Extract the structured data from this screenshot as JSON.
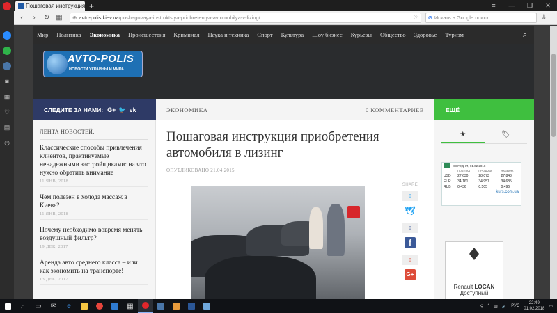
{
  "browser": {
    "tab_title": "Пошаговая инструкция п",
    "tab_close": "×",
    "new_tab": "+",
    "url_host": "avto-polis.kiev.ua",
    "url_path": "/poshagovaya-instruktsiya-priobreteniya-avtomobilya-v-lizing/",
    "search_placeholder": "Искать в Google поиск"
  },
  "nav": {
    "items": [
      "Мир",
      "Политика",
      "Экономика",
      "Происшествия",
      "Криминал",
      "Наука и техника",
      "Спорт",
      "Культура",
      "Шоу бизнес",
      "Курьезы",
      "Общество",
      "Здоровье",
      "Туризм"
    ],
    "active": "Экономика"
  },
  "logo": {
    "name": "AVTO-POLIS",
    "tagline": "НОВОСТИ УКРАИНЫ И МИРА"
  },
  "bar": {
    "follow": "СЛЕДИТЕ ЗА НАМИ:",
    "category": "ЭКОНОМИКА",
    "comments": "0 КОММЕНТАРИЕВ",
    "more": "ЕЩЁ"
  },
  "feed": {
    "title": "ЛЕНТА НОВОСТЕЙ:",
    "items": [
      {
        "title": "Классические способы привлечения клиентов, практикуемые ненадежными застройщиками: на что нужно обратить внимание",
        "date": "11 ЯНВ, 2018"
      },
      {
        "title": "Чем полезен в холода массаж в Киеве?",
        "date": "11 ЯНВ, 2018"
      },
      {
        "title": "Почему необходимо вовремя менять воздушный фильтр?",
        "date": "19 ДЕК, 2017"
      },
      {
        "title": "Аренда авто среднего класса – или как экономить на транспорте!",
        "date": "13 ДЕК, 2017"
      }
    ]
  },
  "article": {
    "headline": "Пошаговая инструкция приобретения автомобиля в лизинг",
    "published": "ОПУБЛИКОВАНО 21.04.2015"
  },
  "share": {
    "label": "SHARE",
    "twitter_count": "0",
    "facebook_count": "0",
    "googleplus_count": "0"
  },
  "kurs": {
    "header": "СЕГОДНЯ, 01.02.2018",
    "cols": [
      "ПОКУПКА",
      "ПРОДАЖА",
      "НАЦБАНК"
    ],
    "rows": [
      {
        "cur": "USD",
        "buy": "27.630",
        "sell": "28.073",
        "nbu": "27.843"
      },
      {
        "cur": "EUR",
        "buy": "34.161",
        "sell": "34.957",
        "nbu": "34.685"
      },
      {
        "cur": "RUB",
        "buy": "0.436",
        "sell": "0.505",
        "nbu": "0.496"
      }
    ],
    "source": "kurs.com.ua"
  },
  "ad": {
    "brand": "Renault",
    "model": "LOGAN",
    "slogan": "Доступный"
  },
  "taskbar": {
    "lang": "РУС",
    "time": "22:49",
    "date": "01.02.2018"
  },
  "colors": {
    "nav_bg": "#2b2b2b",
    "follow_bg": "#2e3a66",
    "more_bg": "#3fbf3f",
    "logo_bg": "#1e70b4"
  }
}
